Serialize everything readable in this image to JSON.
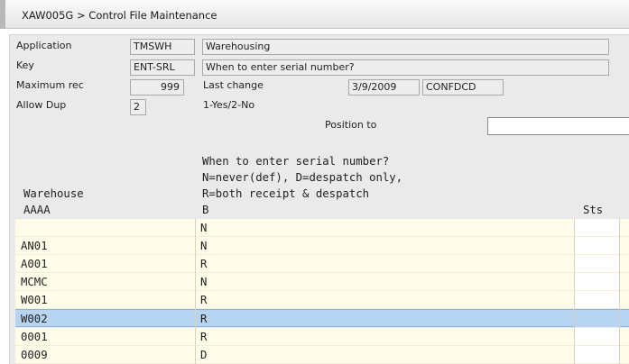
{
  "window": {
    "title": "XAW005G > Control File Maintenance"
  },
  "form": {
    "application_label": "Application",
    "application_code": "TMSWH",
    "application_desc": "Warehousing",
    "key_label": "Key",
    "key_code": "ENT-SRL",
    "key_desc": "When to enter serial number?",
    "maxrec_label": "Maximum rec",
    "maxrec_value": "999",
    "lastchange_label": "Last change",
    "lastchange_date": "3/9/2009",
    "lastchange_user": "CONFDCD",
    "allowdup_label": "Allow Dup",
    "allowdup_value": "2",
    "allowdup_hint": "1-Yes/2-No",
    "position_label": "Position to",
    "position_value": ""
  },
  "header": {
    "desc_line1": "When to enter serial number?",
    "desc_line2": "N=never(def), D=despatch only,",
    "desc_line3": "R=both receipt & despatch",
    "col1_title": "Warehouse",
    "col1_sub": "AAAA",
    "col2_sub": "B",
    "col3_title": "Sts"
  },
  "rows": [
    {
      "warehouse": "",
      "value": "N",
      "selected": false
    },
    {
      "warehouse": "AN01",
      "value": "N",
      "selected": false
    },
    {
      "warehouse": "A001",
      "value": "R",
      "selected": false
    },
    {
      "warehouse": "MCMC",
      "value": "N",
      "selected": false
    },
    {
      "warehouse": "W001",
      "value": "R",
      "selected": false
    },
    {
      "warehouse": "W002",
      "value": "R",
      "selected": true
    },
    {
      "warehouse": "0001",
      "value": "R",
      "selected": false
    },
    {
      "warehouse": "0009",
      "value": "D",
      "selected": false
    }
  ]
}
